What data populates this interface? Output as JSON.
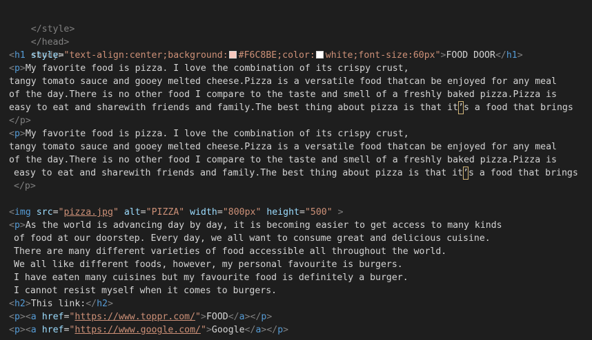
{
  "editor": {
    "lines": {
      "l1": "</style>",
      "l2": "</head>",
      "l3": "<body>",
      "l4": {
        "open": "<",
        "tag": "h1",
        "attr_style": "style",
        "eq": "=",
        "q_open": "\"text-align:center;background:",
        "color1": "#F6C8BE",
        "swatch1_color": "#F6C8BE",
        "mid": ";color:",
        "swatch2_color": "#FFFFFF",
        "color2": "white;font-size:60px\"",
        "close": ">",
        "text": "FOOD DOOR",
        "end_open": "</",
        "end_tag": "h1",
        "end_close": ">"
      },
      "p1": {
        "open": "<",
        "tag": "p",
        "close": ">",
        "line1": "My favorite food is pizza. I love the combination of its crispy crust,",
        "line2": "tangy tomato sauce and gooey melted cheese.Pizza is a versatile food thatcan be enjoyed for any meal",
        "line3": "of the day.There is no other food I compare to the taste and smell of a freshly baked pizza.Pizza is",
        "line4_a": "easy to eat and sharewith friends and family.The best thing about pizza is that it",
        "line4_apos": "’",
        "line4_b": "s a food that brings",
        "end": "</p>"
      },
      "p2": {
        "open": "<",
        "tag": "p",
        "close": ">",
        "line1": "My favorite food is pizza. I love the combination of its crispy crust,",
        "line2": "tangy tomato sauce and gooey melted cheese.Pizza is a versatile food thatcan be enjoyed for any meal",
        "line3": "of the day.There is no other food I compare to the taste and smell of a freshly baked pizza.Pizza is",
        "line4_a": "easy to eat and sharewith friends and family.The best thing about pizza is that it",
        "line4_apos": "’",
        "line4_b": "s a food that brings",
        "end": "</p>"
      },
      "img": {
        "open": "<",
        "tag": "img",
        "src_attr": "src",
        "src_val": "pizza.jpg",
        "alt_attr": "alt",
        "alt_val": "\"PIZZA\"",
        "width_attr": "width",
        "width_val": "\"800px\"",
        "height_attr": "height",
        "height_val": "\"500\"",
        "close": ">"
      },
      "p3": {
        "open": "<",
        "tag": "p",
        "close": ">",
        "line1": "As the world is advancing day by day, it is becoming easier to get access to many kinds",
        "line2": "of food at our doorstep. Every day, we all want to consume great and delicious cuisine.",
        "line3": "There are many different varieties of food accessible all throughout the world.",
        "line4": "We all like different foods, however, my personal favourite is burgers.",
        "line5": "I have eaten many cuisines but my favourite food is definitely a burger.",
        "line6": "I cannot resist myself when it comes to burgers."
      },
      "h2": {
        "open": "<",
        "tag": "h2",
        "close": ">",
        "text": "This link:",
        "end_open": "</",
        "end_tag": "h2",
        "end_close": ">"
      },
      "link1": {
        "href_attr": "href",
        "url": "https://www.toppr.com/",
        "text": "FOOD"
      },
      "link2": {
        "href_attr": "href",
        "url": "https://www.google.com/",
        "text": "Google"
      }
    }
  }
}
